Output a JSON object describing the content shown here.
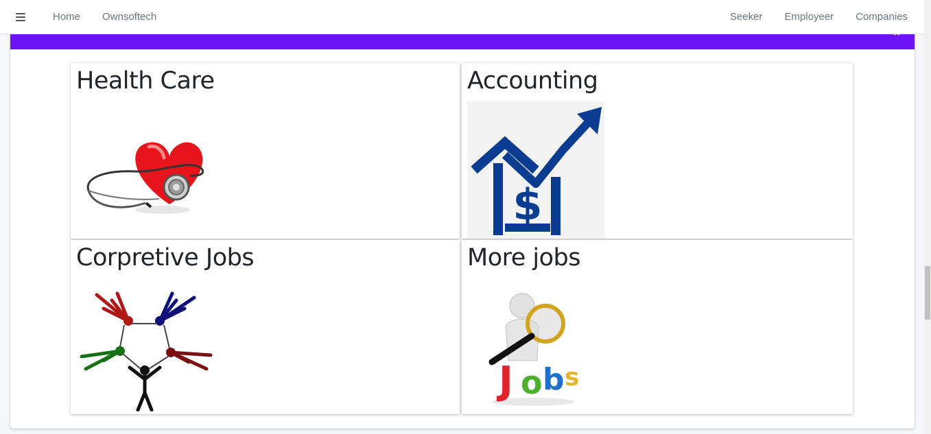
{
  "navbar": {
    "menu_icon": "hamburger-icon",
    "left_links": [
      "Home",
      "Ownsoftech"
    ],
    "right_links": [
      "Seeker",
      "Employeer",
      "Companies"
    ]
  },
  "card": {
    "close_icon": "close-icon",
    "header_color": "#6d12f5"
  },
  "categories": [
    {
      "title": "Health Care",
      "icon": "heart-stethoscope-image"
    },
    {
      "title": "Accounting",
      "icon": "house-dollar-growth-image"
    },
    {
      "title": "Corpretive Jobs",
      "icon": "people-circle-image"
    },
    {
      "title": "More jobs",
      "icon": "magnifier-jobs-image"
    }
  ]
}
